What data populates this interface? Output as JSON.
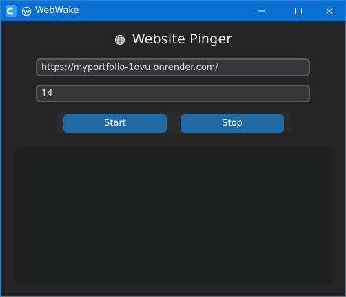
{
  "window": {
    "title": "WebWake",
    "accent_color": "#0a6fd2"
  },
  "header": {
    "title": "Website Pinger",
    "icon": "globe-icon"
  },
  "form": {
    "url_value": "https://myportfolio-1ovu.onrender.com/",
    "interval_value": "14"
  },
  "buttons": {
    "start_label": "Start",
    "stop_label": "Stop",
    "color": "#1f6aa5"
  },
  "log": {
    "text": ""
  }
}
